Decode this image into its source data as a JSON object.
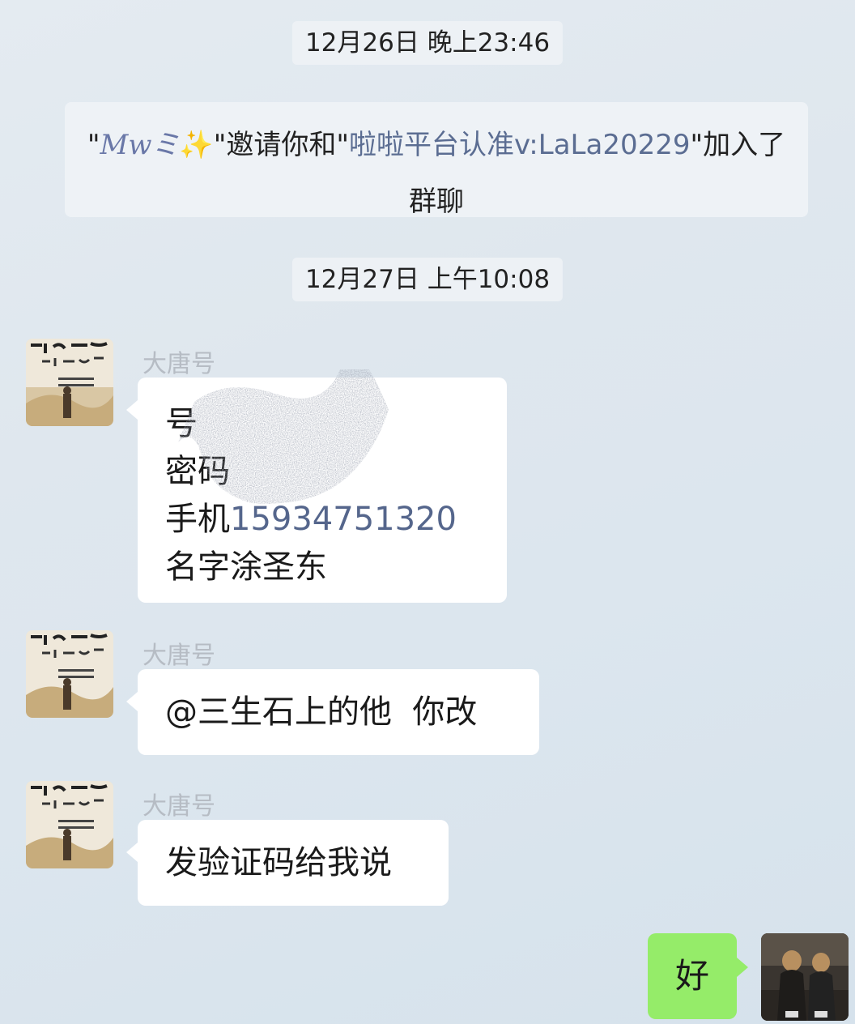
{
  "chat": {
    "timestamps": [
      "12月26日 晚上23:46",
      "12月27日 上午10:08"
    ],
    "system_message": {
      "quote_open": "\"",
      "inviter_name": "Mw",
      "inviter_ornament": "ミ",
      "sparkle": "✨",
      "text_part1": "\"邀请你和\"",
      "invitee": "啦啦平台认准v:LaLa20229",
      "text_part2": "\"加入了群聊"
    },
    "messages": [
      {
        "sender": "大唐号",
        "lines": [
          {
            "label": "号",
            "value": ""
          },
          {
            "label": "密码",
            "value": ""
          },
          {
            "label": "手机",
            "value": "15934751320"
          },
          {
            "label": "名字涂圣东",
            "value": ""
          }
        ]
      },
      {
        "sender": "大唐号",
        "text": "@三生石上的他  你改"
      },
      {
        "sender": "大唐号",
        "text": "发验证码给我说"
      },
      {
        "sender": "",
        "text": "好",
        "outgoing": true
      }
    ]
  },
  "colors": {
    "bubble_incoming": "#ffffff",
    "bubble_outgoing": "#95ec69",
    "link_text": "#5b6d92",
    "sender_name": "#b6bcc4"
  }
}
